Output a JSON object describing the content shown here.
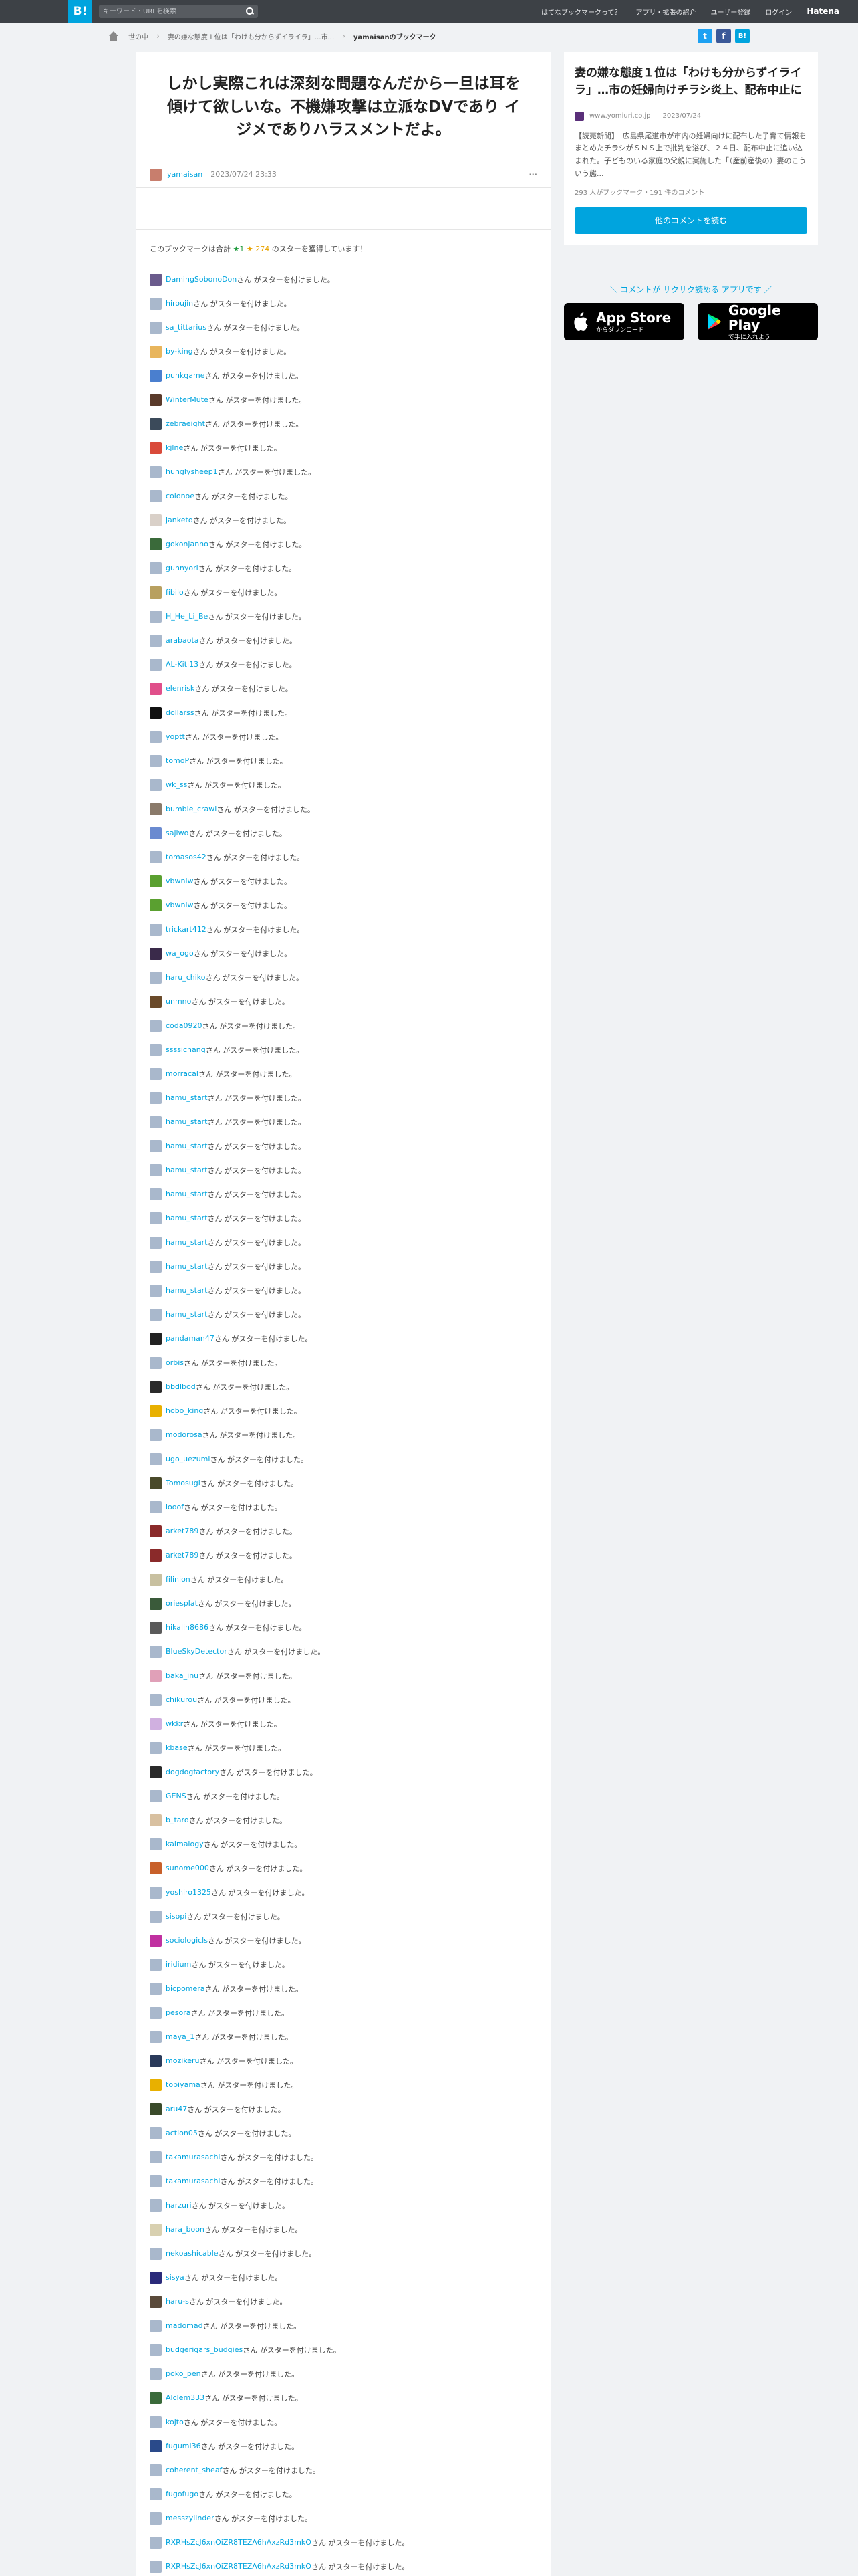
{
  "header": {
    "logo": "B!",
    "search_placeholder": "キーワード・URLを検索",
    "nav": [
      "はてなブックマークって？",
      "アプリ・拡張の紹介",
      "ユーザー登録",
      "ログイン",
      "Hatena"
    ]
  },
  "breadcrumb": {
    "items": [
      "世の中",
      "妻の嫌な態度１位は「わけも分からずイライラ」…市...",
      "yamaisanのブックマーク"
    ]
  },
  "share": {
    "twitter": "t",
    "facebook": "f",
    "hatena": "B!"
  },
  "bookmark": {
    "comment": "しかし実際これは深刻な問題なんだから一旦は耳を傾けて欲しいな。不機嫌攻撃は立派なDVであり イジメでありハラスメントだよ。",
    "user": "yamaisan",
    "date": "2023/07/24 23:33",
    "more": "···"
  },
  "starinfo": {
    "prefix": "このブックマークは合計",
    "green_star": "★1",
    "yellow_star": "★ 274",
    "suffix": "のスターを獲得しています！"
  },
  "star_suffix": "さん がスターを付けました。",
  "stars": [
    {
      "user": "DamingSobonoDon",
      "color": "#6a5b8c"
    },
    {
      "user": "hiroujin",
      "color": "#a9b8cc"
    },
    {
      "user": "sa_tittarius",
      "color": "#a9b8cc"
    },
    {
      "user": "by-king",
      "color": "#e8b55c"
    },
    {
      "user": "punkgame",
      "color": "#4a7fcf"
    },
    {
      "user": "WinterMute",
      "color": "#5a3a2a"
    },
    {
      "user": "zebraeight",
      "color": "#3b4a5a"
    },
    {
      "user": "kjlne",
      "color": "#d94a3a"
    },
    {
      "user": "hunglysheep1",
      "color": "#a9b8cc"
    },
    {
      "user": "colonoe",
      "color": "#a9b8cc"
    },
    {
      "user": "janketo",
      "color": "#d9d0c8"
    },
    {
      "user": "gokonjanno",
      "color": "#3a6a3a"
    },
    {
      "user": "gunnyori",
      "color": "#a9b8cc"
    },
    {
      "user": "fibilo",
      "color": "#b8a060"
    },
    {
      "user": "H_He_Li_Be",
      "color": "#a9b8cc"
    },
    {
      "user": "arabaota",
      "color": "#a9b8cc"
    },
    {
      "user": "AL-Kiti13",
      "color": "#a9b8cc"
    },
    {
      "user": "elenrisk",
      "color": "#e04f8a"
    },
    {
      "user": "dollarss",
      "color": "#111111"
    },
    {
      "user": "yoptt",
      "color": "#a9b8cc"
    },
    {
      "user": "tomoP",
      "color": "#a9b8cc"
    },
    {
      "user": "wk_ss",
      "color": "#a9b8cc"
    },
    {
      "user": "bumble_crawl",
      "color": "#8a7a6a"
    },
    {
      "user": "sajiwo",
      "color": "#6a8ad0"
    },
    {
      "user": "tomasos42",
      "color": "#a9b8cc"
    },
    {
      "user": "vbwnlw",
      "color": "#5aa030"
    },
    {
      "user": "vbwnlw",
      "color": "#5aa030"
    },
    {
      "user": "trickart412",
      "color": "#a9b8cc"
    },
    {
      "user": "wa_ogo",
      "color": "#3a2a4a"
    },
    {
      "user": "haru_chiko",
      "color": "#a9b8cc"
    },
    {
      "user": "unmno",
      "color": "#6a4a2a"
    },
    {
      "user": "coda0920",
      "color": "#a9b8cc"
    },
    {
      "user": "ssssichang",
      "color": "#a9b8cc"
    },
    {
      "user": "morracal",
      "color": "#a9b8cc"
    },
    {
      "user": "hamu_start",
      "color": "#a9b8cc"
    },
    {
      "user": "hamu_start",
      "color": "#a9b8cc"
    },
    {
      "user": "hamu_start",
      "color": "#a9b8cc"
    },
    {
      "user": "hamu_start",
      "color": "#a9b8cc"
    },
    {
      "user": "hamu_start",
      "color": "#a9b8cc"
    },
    {
      "user": "hamu_start",
      "color": "#a9b8cc"
    },
    {
      "user": "hamu_start",
      "color": "#a9b8cc"
    },
    {
      "user": "hamu_start",
      "color": "#a9b8cc"
    },
    {
      "user": "hamu_start",
      "color": "#a9b8cc"
    },
    {
      "user": "hamu_start",
      "color": "#a9b8cc"
    },
    {
      "user": "pandaman47",
      "color": "#222222"
    },
    {
      "user": "orbis",
      "color": "#a9b8cc"
    },
    {
      "user": "bbdlbod",
      "color": "#2a2a2a"
    },
    {
      "user": "hobo_king",
      "color": "#e8b000"
    },
    {
      "user": "modorosa",
      "color": "#a9b8cc"
    },
    {
      "user": "ugo_uezumi",
      "color": "#a9b8cc"
    },
    {
      "user": "Tomosugi",
      "color": "#4a4a2a"
    },
    {
      "user": "looof",
      "color": "#a9b8cc"
    },
    {
      "user": "arket789",
      "color": "#8a2a2a"
    },
    {
      "user": "arket789",
      "color": "#8a2a2a"
    },
    {
      "user": "filinion",
      "color": "#c8c0a0"
    },
    {
      "user": "oriesplat",
      "color": "#3a5a3a"
    },
    {
      "user": "hikalin8686",
      "color": "#5a5a5a"
    },
    {
      "user": "BlueSkyDetector",
      "color": "#a9b8cc"
    },
    {
      "user": "baka_inu",
      "color": "#e0a0b8"
    },
    {
      "user": "chikurou",
      "color": "#a9b8cc"
    },
    {
      "user": "wkkr",
      "color": "#d0b0e0"
    },
    {
      "user": "kbase",
      "color": "#a9b8cc"
    },
    {
      "user": "dogdogfactory",
      "color": "#2a2a2a"
    },
    {
      "user": "GENS",
      "color": "#a9b8cc"
    },
    {
      "user": "b_taro",
      "color": "#d8c0a0"
    },
    {
      "user": "kalmalogy",
      "color": "#a9b8cc"
    },
    {
      "user": "sunome000",
      "color": "#c8602a"
    },
    {
      "user": "yoshiro1325",
      "color": "#a9b8cc"
    },
    {
      "user": "sisopi",
      "color": "#a9b8cc"
    },
    {
      "user": "sociologicls",
      "color": "#c030a0"
    },
    {
      "user": "iridium",
      "color": "#a9b8cc"
    },
    {
      "user": "bicpomera",
      "color": "#a9b8cc"
    },
    {
      "user": "pesora",
      "color": "#a9b8cc"
    },
    {
      "user": "maya_1",
      "color": "#a9b8cc"
    },
    {
      "user": "mozikeru",
      "color": "#2a3a5a"
    },
    {
      "user": "topiyama",
      "color": "#e8b000"
    },
    {
      "user": "aru47",
      "color": "#3a4a2a"
    },
    {
      "user": "action05",
      "color": "#a9b8cc"
    },
    {
      "user": "takamurasachi",
      "color": "#a9b8cc"
    },
    {
      "user": "takamurasachi",
      "color": "#a9b8cc"
    },
    {
      "user": "harzuri",
      "color": "#a9b8cc"
    },
    {
      "user": "hara_boon",
      "color": "#d8d0b0"
    },
    {
      "user": "nekoashicable",
      "color": "#a9b8cc"
    },
    {
      "user": "sisya",
      "color": "#2a2a7a"
    },
    {
      "user": "haru-s",
      "color": "#5a4a3a"
    },
    {
      "user": "madomad",
      "color": "#a9b8cc"
    },
    {
      "user": "budgerigars_budgies",
      "color": "#a9b8cc"
    },
    {
      "user": "poko_pen",
      "color": "#a9b8cc"
    },
    {
      "user": "Alclem333",
      "color": "#3a6a3a"
    },
    {
      "user": "kojto",
      "color": "#a9b8cc"
    },
    {
      "user": "fugumi36",
      "color": "#2a4a8a"
    },
    {
      "user": "coherent_sheaf",
      "color": "#a9b8cc"
    },
    {
      "user": "fugofugo",
      "color": "#a9b8cc"
    },
    {
      "user": "messzylinder",
      "color": "#a9b8cc"
    },
    {
      "user": "RXRHsZcJ6xnOiZR8TEZA6hAxzRd3mkO",
      "color": "#a9b8cc"
    },
    {
      "user": "RXRHsZcJ6xnOiZR8TEZA6hAxzRd3mkO",
      "color": "#a9b8cc"
    }
  ],
  "entry": {
    "title": "妻の嫌な態度１位は「わけも分からずイライラ」…市の妊婦向けチラシ炎上、配布中止に",
    "site": "www.yomiuri.co.jp",
    "date": "2023/07/24",
    "summary": "【読売新聞】　広島県尾道市が市内の妊婦向けに配布した子育て情報をまとめたチラシがＳＮＳ上で批判を浴び、２４日、配布中止に追い込まれた。子どものいる家庭の父親に実施した「（産前産後の）妻のこういう態...",
    "counts": "293 人がブックマーク・191 件のコメント",
    "read_button": "他のコメントを読む"
  },
  "apps": {
    "lead": "＼ コメントが サクサク読める アプリです ／",
    "appstore": {
      "big": "App Store",
      "small": "からダウンロード"
    },
    "googleplay": {
      "big": "Google Play",
      "small": "で手に入れよう"
    }
  },
  "colors": {
    "accent": "#00a4de",
    "header": "#3d4146",
    "green_star": "#1f9b3d",
    "yellow_star": "#e8a300"
  }
}
